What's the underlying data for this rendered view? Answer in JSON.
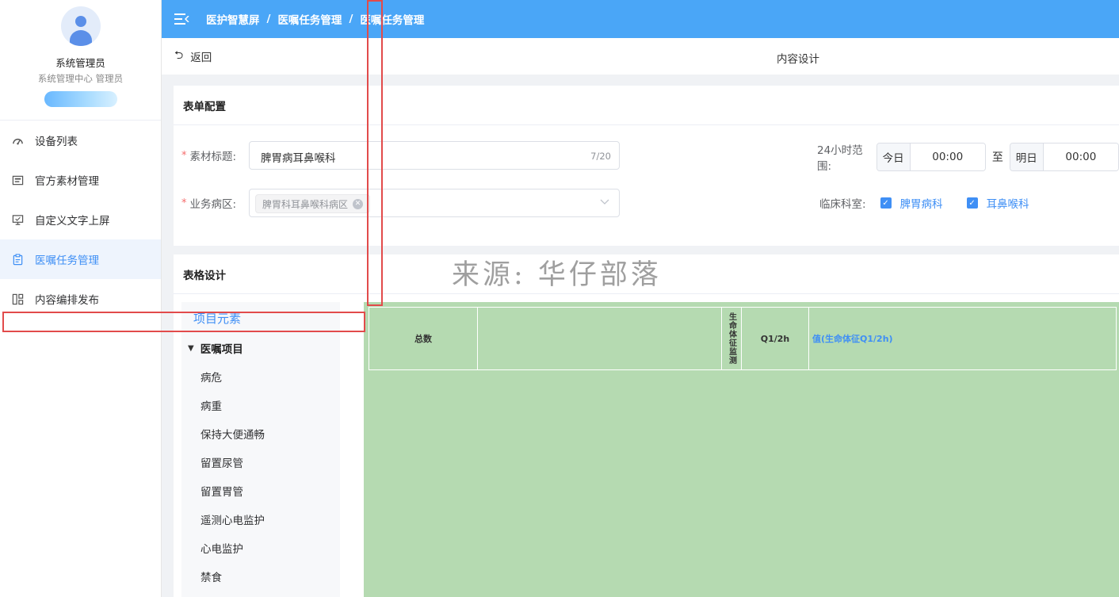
{
  "user": {
    "name": "系统管理员",
    "role": "系统管理中心  管理员"
  },
  "menu": [
    {
      "label": "设备列表",
      "icon": "gauge-icon",
      "active": false
    },
    {
      "label": "官方素材管理",
      "icon": "picture-icon",
      "active": false
    },
    {
      "label": "自定义文字上屏",
      "icon": "monitor-icon",
      "active": false
    },
    {
      "label": "医嘱任务管理",
      "icon": "clipboard-icon",
      "active": true
    },
    {
      "label": "内容编排发布",
      "icon": "layout-icon",
      "active": false
    }
  ],
  "breadcrumb": [
    "医护智慧屏",
    "医嘱任务管理",
    "医嘱任务管理"
  ],
  "subbar": {
    "back_label": "返回",
    "page_title": "内容设计"
  },
  "form": {
    "panel_title": "表单配置",
    "title_label": "素材标题:",
    "title_value": "脾胃病耳鼻喉科",
    "title_count": "7/20",
    "ward_label": "业务病区:",
    "ward_chip": "脾胃科耳鼻喉科病区",
    "range_label": "24小时范围:",
    "range_start_prefix": "今日",
    "range_start_time": "00:00",
    "range_to": "至",
    "range_end_prefix": "明日",
    "range_end_time": "00:00",
    "dept_label": "临床科室:",
    "depts": [
      "脾胃病科",
      "耳鼻喉科"
    ]
  },
  "table_design": {
    "panel_title": "表格设计",
    "elements_header": "项目元素",
    "group_label": "医嘱项目",
    "items": [
      "病危",
      "病重",
      "保持大便通畅",
      "留置尿管",
      "留置胃管",
      "遥测心电监护",
      "心电监护",
      "禁食"
    ]
  },
  "grid": {
    "total_label": "总数",
    "vital_label": "生命体征监测",
    "freq_label": "Q1/2h",
    "value_label": "值(生命体征Q1/2h)"
  },
  "watermark": "来源: 华仔部落",
  "colors": {
    "header_bg": "#4aa6f7",
    "accent": "#3f8ff5",
    "canvas_bg": "#b5dab1",
    "annotation_red": "#e24b4b"
  }
}
